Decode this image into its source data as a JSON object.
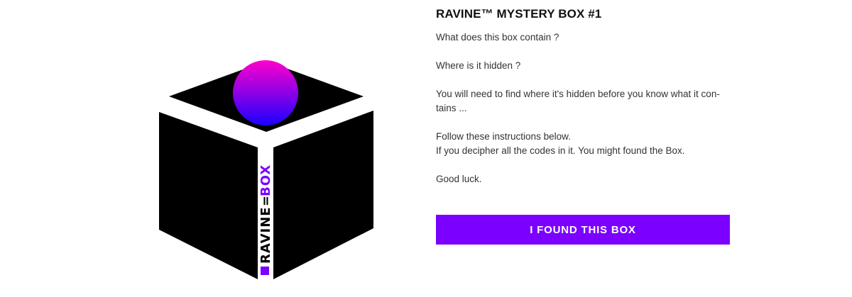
{
  "product": {
    "title": "RAVINE™ MYSTERY BOX #1",
    "image": {
      "alt": "Ravine mystery box illustration",
      "logo_text": "RAVINE",
      "logo_box_text": "BOX",
      "sphere_colors": [
        "#ff00cc",
        "#1a00ff"
      ],
      "accent_color": "#7b00ff"
    },
    "description": {
      "line1": "What does this box contain ?",
      "line2": "Where is it hidden ?",
      "line3": "You will need to find where it's hidden before you know what it con-tains ...",
      "line4a": "Follow these instructions below.",
      "line4b": "If you decipher all the codes in it. You might found the Box.",
      "line5": "Good luck."
    },
    "action": {
      "found_label": "I FOUND THIS BOX"
    }
  }
}
